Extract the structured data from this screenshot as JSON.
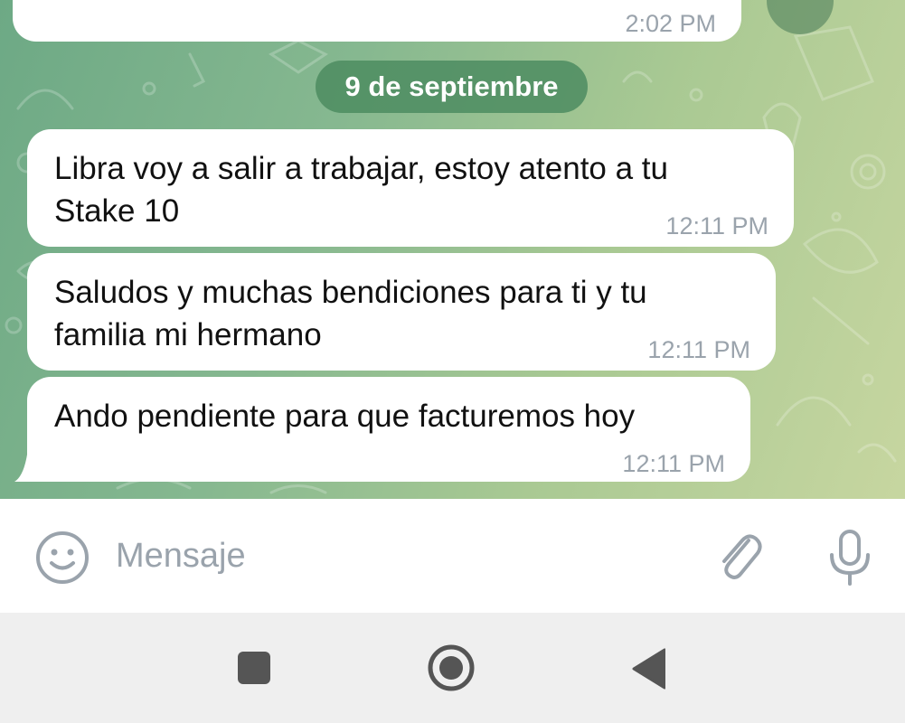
{
  "chat": {
    "previous_message": {
      "time": "2:02 PM"
    },
    "date_separator": "9 de septiembre",
    "messages": [
      {
        "line1": "Libra voy a salir a trabajar, estoy atento a tu",
        "line2": "Stake 10",
        "time": "12:11 PM"
      },
      {
        "line1": "Saludos y muchas bendiciones para ti y tu",
        "line2": "familia mi hermano",
        "time": "12:11 PM"
      },
      {
        "line1": "Ando pendiente para que facturemos hoy",
        "time": "12:11 PM"
      }
    ]
  },
  "composer": {
    "placeholder": "Mensaje",
    "icons": [
      "emoji-icon",
      "attach-icon",
      "microphone-icon"
    ]
  },
  "navigation": {
    "icons": [
      "recents-square-icon",
      "home-circle-icon",
      "back-triangle-icon"
    ]
  },
  "colors": {
    "wallpaper_start": "#6da985",
    "wallpaper_end": "#c7d6a0",
    "date_pill": "#4c8c60",
    "timestamp": "#9aa3ac",
    "icon_gray": "#9aa3ac",
    "nav_icon": "#555555"
  }
}
